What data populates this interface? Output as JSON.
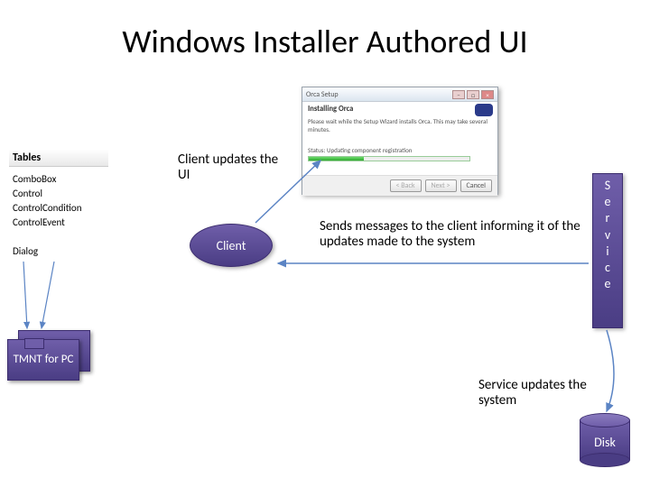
{
  "title": "Windows Installer Authored UI",
  "tables": {
    "header": "Tables",
    "rows": [
      "ComboBox",
      "Control",
      "ControlCondition",
      "ControlEvent",
      "",
      "Dialog"
    ]
  },
  "tmnt": {
    "label": "TMNT for PC"
  },
  "client": {
    "label": "Client"
  },
  "service": {
    "letters": [
      "S",
      "e",
      "r",
      "v",
      "i",
      "c",
      "e"
    ]
  },
  "disk": {
    "label": "Disk"
  },
  "labels": {
    "client_updates": "Client updates the UI",
    "sends_messages": "Sends messages to the client informing it of the updates made to the system",
    "service_updates": "Service updates the system"
  },
  "wizard": {
    "window_title": "Orca Setup",
    "heading": "Installing Orca",
    "subtext": "Please wait while the Setup Wizard installs Orca. This may take several minutes.",
    "status_label": "Status:",
    "status_value": "Updating component registration",
    "buttons": {
      "back": "< Back",
      "next": "Next >",
      "cancel": "Cancel"
    }
  }
}
